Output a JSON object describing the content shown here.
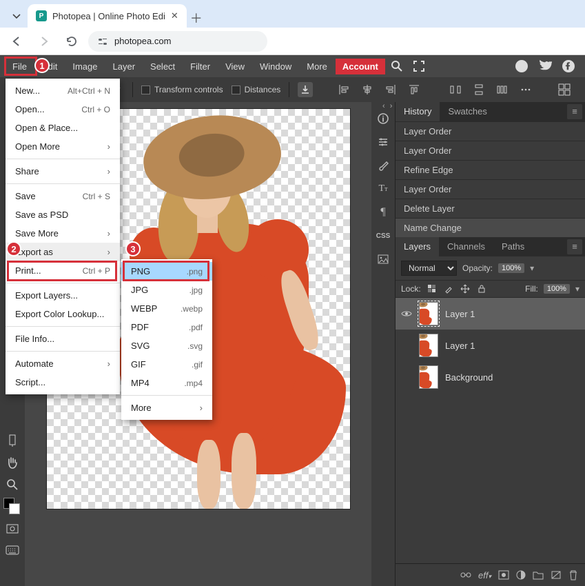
{
  "browser": {
    "tab_title": "Photopea | Online Photo Edi",
    "url": "photopea.com"
  },
  "menubar": {
    "items": [
      "File",
      "Edit",
      "Image",
      "Layer",
      "Select",
      "Filter",
      "View",
      "Window",
      "More"
    ],
    "account": "Account"
  },
  "options": {
    "transform_controls": "Transform controls",
    "distances": "Distances"
  },
  "file_menu": {
    "items": [
      {
        "label": "New...",
        "shortcut": "Alt+Ctrl + N"
      },
      {
        "label": "Open...",
        "shortcut": "Ctrl + O"
      },
      {
        "label": "Open & Place..."
      },
      {
        "label": "Open More",
        "sub": true
      },
      {
        "label": "Share",
        "sub": true,
        "sep_before": true
      },
      {
        "label": "Save",
        "shortcut": "Ctrl + S",
        "sep_before": true
      },
      {
        "label": "Save as PSD"
      },
      {
        "label": "Save More",
        "sub": true
      },
      {
        "label": "Export as",
        "sub": true
      },
      {
        "label": "Print...",
        "shortcut": "Ctrl + P"
      },
      {
        "label": "Export Layers...",
        "sep_before": true
      },
      {
        "label": "Export Color Lookup..."
      },
      {
        "label": "File Info...",
        "sep_before": true
      },
      {
        "label": "Automate",
        "sub": true,
        "sep_before": true
      },
      {
        "label": "Script..."
      }
    ]
  },
  "export_submenu": {
    "items": [
      {
        "label": "PNG",
        "ext": ".png"
      },
      {
        "label": "JPG",
        "ext": ".jpg"
      },
      {
        "label": "WEBP",
        "ext": ".webp"
      },
      {
        "label": "PDF",
        "ext": ".pdf"
      },
      {
        "label": "SVG",
        "ext": ".svg"
      },
      {
        "label": "GIF",
        "ext": ".gif"
      },
      {
        "label": "MP4",
        "ext": ".mp4"
      },
      {
        "label": "More",
        "sub": true,
        "sep_before": true
      }
    ]
  },
  "panels": {
    "history": {
      "tabs": [
        "History",
        "Swatches"
      ],
      "items": [
        "Layer Order",
        "Layer Order",
        "Refine Edge",
        "Layer Order",
        "Delete Layer",
        "Name Change"
      ]
    },
    "layers": {
      "tabs": [
        "Layers",
        "Channels",
        "Paths"
      ],
      "blend_mode": "Normal",
      "opacity_label": "Opacity:",
      "opacity_value": "100%",
      "lock_label": "Lock:",
      "fill_label": "Fill:",
      "fill_value": "100%",
      "rows": [
        {
          "name": "Layer 1",
          "visible": true,
          "selected": true
        },
        {
          "name": "Layer 1",
          "visible": false,
          "selected": false
        },
        {
          "name": "Background",
          "visible": false,
          "selected": false
        }
      ],
      "footer_eff": "eff"
    }
  },
  "right_iconstrip": [
    "ⓘ",
    "≡",
    "🖌",
    "Tт",
    "¶",
    "CSS",
    "🖼"
  ],
  "callouts": {
    "c1": "1",
    "c2": "2",
    "c3": "3"
  }
}
